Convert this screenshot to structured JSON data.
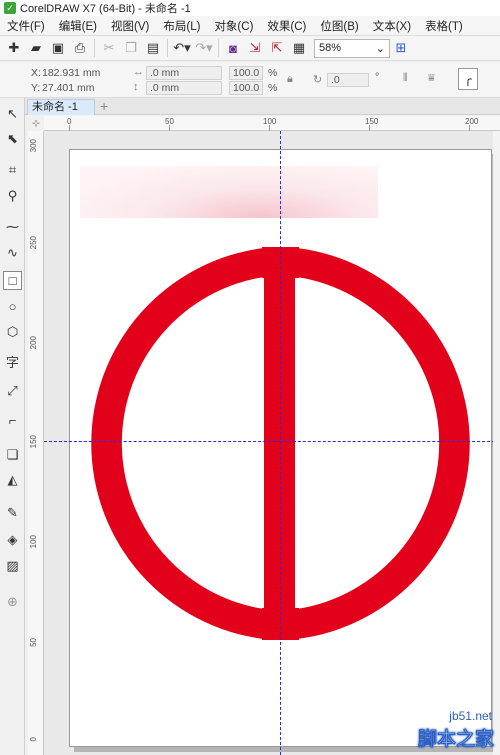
{
  "app": {
    "title": "CorelDRAW X7 (64-Bit) - 未命名 -1"
  },
  "menu": [
    "文件(F)",
    "编辑(E)",
    "视图(V)",
    "布局(L)",
    "对象(C)",
    "效果(C)",
    "位图(B)",
    "文本(X)",
    "表格(T)"
  ],
  "toolbar": {
    "zoom_value": "58%"
  },
  "propbar": {
    "x_label": "X:",
    "x_value": "182.931 mm",
    "y_label": "Y:",
    "y_value": "27.401 mm",
    "w_value": ".0 mm",
    "h_value": ".0 mm",
    "scale_x": "100.0",
    "scale_y": "100.0",
    "percent_unit": "%",
    "angle_value": ".0",
    "degree_unit": "°"
  },
  "document": {
    "tab_label": "未命名 -1"
  },
  "ruler": {
    "h_labels": [
      "0",
      "50",
      "100",
      "150",
      "200"
    ],
    "v_labels": [
      "300",
      "250",
      "200",
      "150",
      "100",
      "50",
      "0"
    ],
    "unit_label": "毫米"
  },
  "drawing": {
    "shape_color": "#e3001b",
    "guide_color": "#2a2ad6"
  },
  "watermark": {
    "site": "jb51.net",
    "name": "脚本之家"
  }
}
